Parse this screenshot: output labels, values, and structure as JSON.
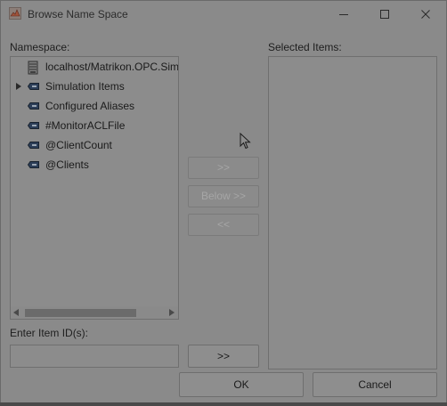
{
  "window": {
    "title": "Browse Name Space"
  },
  "namespace": {
    "label": "Namespace:",
    "items": [
      {
        "label": "localhost/Matrikon.OPC.Sim",
        "icon": "server-icon",
        "expandable": false
      },
      {
        "label": "Simulation Items",
        "icon": "tag-icon",
        "expandable": true
      },
      {
        "label": "Configured Aliases",
        "icon": "tag-icon",
        "expandable": false
      },
      {
        "label": "#MonitorACLFile",
        "icon": "tag-icon",
        "expandable": false
      },
      {
        "label": "@ClientCount",
        "icon": "tag-icon",
        "expandable": false
      },
      {
        "label": "@Clients",
        "icon": "tag-icon",
        "expandable": false
      }
    ]
  },
  "selected": {
    "label": "Selected Items:"
  },
  "transfer": {
    "add_label": ">>",
    "add_below_label": "Below >>",
    "remove_label": "<<"
  },
  "item_id": {
    "label": "Enter Item ID(s):",
    "value": "",
    "add_label": ">>"
  },
  "footer": {
    "ok_label": "OK",
    "cancel_label": "Cancel"
  }
}
